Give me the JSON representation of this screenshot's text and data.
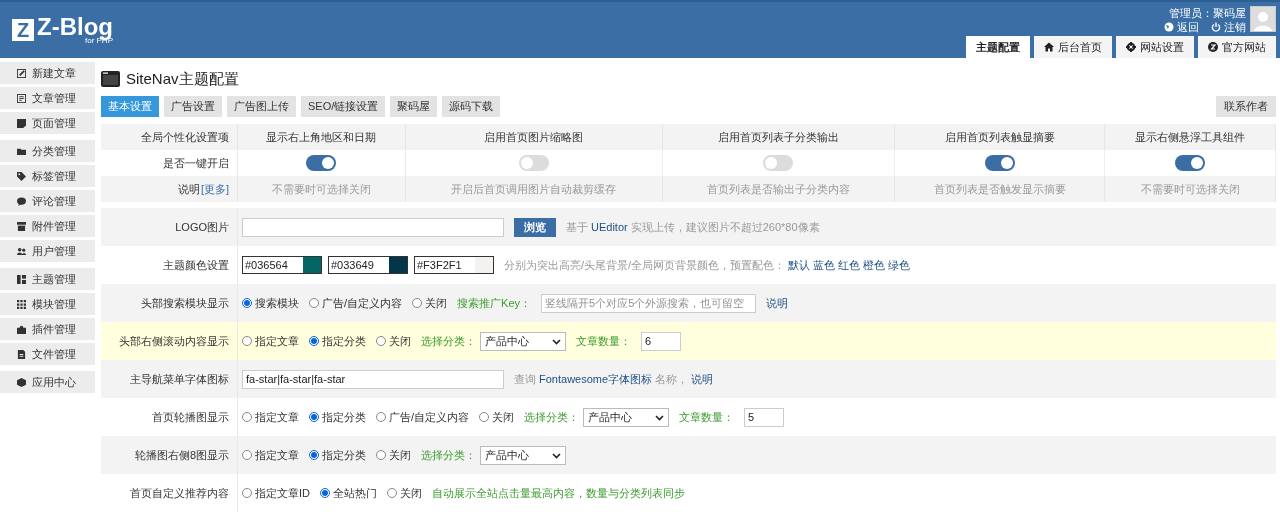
{
  "header": {
    "logo_letter": "Z",
    "logo_text": "Z-Blog",
    "logo_sub": "for PHP",
    "admin": "管理员：聚码屋",
    "links": [
      {
        "label": "返回"
      },
      {
        "label": "注销"
      }
    ],
    "tabs": [
      {
        "label": "主题配置",
        "selected": true
      },
      {
        "label": "后台首页",
        "selected": false
      },
      {
        "label": "网站设置",
        "selected": false
      },
      {
        "label": "官方网站",
        "selected": false
      }
    ]
  },
  "sidebar": {
    "groups": [
      [
        {
          "label": "新建文章"
        },
        {
          "label": "文章管理"
        },
        {
          "label": "页面管理"
        }
      ],
      [
        {
          "label": "分类管理"
        },
        {
          "label": "标签管理"
        },
        {
          "label": "评论管理"
        },
        {
          "label": "附件管理"
        },
        {
          "label": "用户管理"
        }
      ],
      [
        {
          "label": "主题管理"
        },
        {
          "label": "模块管理"
        },
        {
          "label": "插件管理"
        },
        {
          "label": "文件管理"
        }
      ],
      [
        {
          "label": "应用中心"
        }
      ]
    ]
  },
  "page": {
    "title": "SiteNav主题配置",
    "tabs": [
      {
        "label": "基本设置",
        "selected": true
      },
      {
        "label": "广告设置",
        "selected": false
      },
      {
        "label": "广告图上传",
        "selected": false
      },
      {
        "label": "SEO/链接设置",
        "selected": false
      },
      {
        "label": "聚码屋",
        "selected": false
      },
      {
        "label": "源码下载",
        "selected": false
      }
    ],
    "contact_button": "联系作者"
  },
  "toggles": {
    "header_label": "全局个性化设置项",
    "switch_label": "是否一键开启",
    "note_label": "说明",
    "more_link": "[更多]",
    "columns": [
      {
        "title": "显示右上角地区和日期",
        "on": true,
        "note": "不需要时可选择关闭"
      },
      {
        "title": "启用首页图片缩略图",
        "on": false,
        "note": "开启后首页调用图片自动裁剪缓存"
      },
      {
        "title": "启用首页列表子分类输出",
        "on": false,
        "note": "首页列表是否输出子分类内容"
      },
      {
        "title": "启用首页列表触显摘要",
        "on": true,
        "note": "首页列表是否触发显示摘要"
      },
      {
        "title": "显示右侧悬浮工具组件",
        "on": true,
        "note": "不需要时可选择关闭"
      }
    ]
  },
  "settings": [
    {
      "label": "LOGO图片",
      "highlighted": false,
      "controls": [
        {
          "kind": "input"
        },
        {
          "kind": "button",
          "label": "浏览"
        },
        {
          "kind": "note",
          "parts": [
            {
              "kind": "plain",
              "text": "基于"
            },
            {
              "kind": "link",
              "text": "UEditor"
            },
            {
              "kind": "plain",
              "text": "实现上传，建议图片不超过260*80像素"
            }
          ]
        }
      ]
    },
    {
      "label": "主题颜色设置",
      "highlighted": false,
      "controls": [
        {
          "kind": "colors",
          "items": [
            {
              "value": "#036564",
              "color": "#036564"
            },
            {
              "value": "#033649",
              "color": "#033649"
            },
            {
              "value": "#F3F2F1",
              "color": "#f3f2f1"
            }
          ]
        },
        {
          "kind": "note",
          "parts": [
            {
              "kind": "plain",
              "text": "分别为突出高亮/头尾背景/全局网页背景颜色，预置配色："
            },
            {
              "kind": "link",
              "text": "默认"
            },
            {
              "kind": "link",
              "text": "蓝色"
            },
            {
              "kind": "link",
              "text": "红色"
            },
            {
              "kind": "link",
              "text": "橙色"
            },
            {
              "kind": "link",
              "text": "绿色"
            }
          ]
        }
      ]
    },
    {
      "label": "头部搜索模块显示",
      "highlighted": false,
      "controls": [
        {
          "kind": "radios",
          "options": [
            {
              "label": "搜索模块",
              "selected": true
            },
            {
              "label": "广告/自定义内容",
              "selected": false
            },
            {
              "label": "关闭",
              "selected": false
            }
          ]
        },
        {
          "kind": "label",
          "text": "搜索推广Key："
        },
        {
          "kind": "input",
          "placeholder": "竖线隔开5个对应5个外源搜索，也可留空"
        },
        {
          "kind": "note",
          "parts": [
            {
              "kind": "link",
              "text": "说明"
            }
          ]
        }
      ]
    },
    {
      "label": "头部右侧滚动内容显示",
      "highlighted": true,
      "controls": [
        {
          "kind": "radios",
          "options": [
            {
              "label": "指定文章",
              "selected": false
            },
            {
              "label": "指定分类",
              "selected": true
            },
            {
              "label": "关闭",
              "selected": false
            }
          ]
        },
        {
          "kind": "label",
          "text": "选择分类："
        },
        {
          "kind": "select",
          "value": "产品中心"
        },
        {
          "kind": "label",
          "text": "文章数量："
        },
        {
          "kind": "input",
          "value": "6"
        }
      ]
    },
    {
      "label": "主导航菜单字体图标",
      "highlighted": false,
      "controls": [
        {
          "kind": "input",
          "value": "fa-star|fa-star|fa-star"
        },
        {
          "kind": "note",
          "parts": [
            {
              "kind": "plain",
              "text": "查询"
            },
            {
              "kind": "link",
              "text": "Fontawesome字体图标"
            },
            {
              "kind": "plain",
              "text": "名称，"
            },
            {
              "kind": "link",
              "text": "说明"
            }
          ]
        }
      ]
    },
    {
      "label": "首页轮播图显示",
      "highlighted": false,
      "controls": [
        {
          "kind": "radios",
          "options": [
            {
              "label": "指定文章",
              "selected": false
            },
            {
              "label": "指定分类",
              "selected": true
            },
            {
              "label": "广告/自定义内容",
              "selected": false
            },
            {
              "label": "关闭",
              "selected": false
            }
          ]
        },
        {
          "kind": "label",
          "text": "选择分类："
        },
        {
          "kind": "select",
          "value": "产品中心"
        },
        {
          "kind": "label",
          "text": "文章数量："
        },
        {
          "kind": "input",
          "value": "5"
        }
      ]
    },
    {
      "label": "轮播图右侧8图显示",
      "highlighted": false,
      "controls": [
        {
          "kind": "radios",
          "options": [
            {
              "label": "指定文章",
              "selected": false
            },
            {
              "label": "指定分类",
              "selected": true
            },
            {
              "label": "关闭",
              "selected": false
            }
          ]
        },
        {
          "kind": "label",
          "text": "选择分类："
        },
        {
          "kind": "select",
          "value": "产品中心"
        }
      ]
    },
    {
      "label": "首页自定义推荐内容",
      "highlighted": false,
      "controls": [
        {
          "kind": "radios",
          "options": [
            {
              "label": "指定文章ID",
              "selected": false
            },
            {
              "label": "全站热门",
              "selected": true
            },
            {
              "label": "关闭",
              "selected": false
            }
          ]
        },
        {
          "kind": "label",
          "text": "自动展示全站点击量最高内容，数量与分类列表同步"
        }
      ]
    }
  ]
}
